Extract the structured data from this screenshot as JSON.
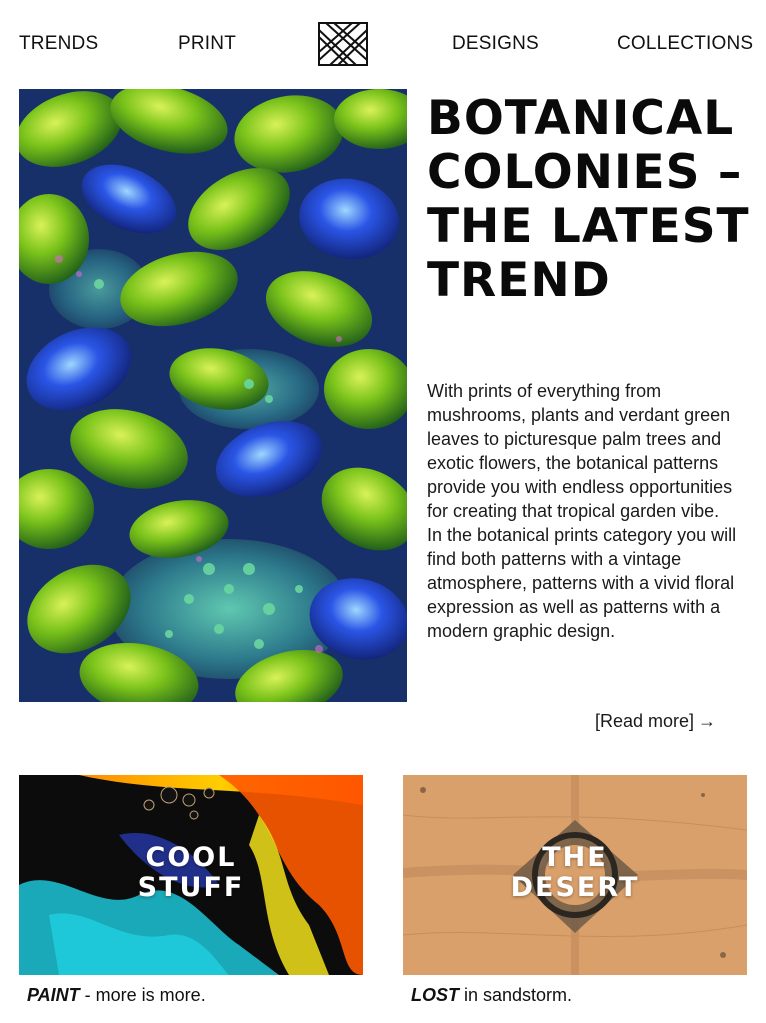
{
  "nav": {
    "items": [
      {
        "label": "TRENDS"
      },
      {
        "label": "PRINT"
      },
      {
        "label": "DESIGNS"
      },
      {
        "label": "COLLECTIONS"
      }
    ],
    "logo_icon": "crossed-lines-logo-icon"
  },
  "hero": {
    "title": "BOTANICAL COLONIES – THE LATEST TREND",
    "body": "With prints of everything from mushrooms, plants and verdant green leaves to picturesque palm trees and exotic flowers, the botanical patterns provide you with endless opportunities for creating that tropical garden vibe. In the botanical prints category you will find both patterns with a vintage atmosphere, patterns with a vivid floral expression as well as patterns with a modern graphic design.",
    "read_more": "[Read more]",
    "arrow": "→"
  },
  "cards": [
    {
      "title_line1": "COOL",
      "title_line2": "STUFF",
      "caption_bold": "PAINT",
      "caption_rest": " - more is more."
    },
    {
      "title_line1": "THE",
      "title_line2": "DESERT",
      "caption_bold": "LOST",
      "caption_rest": " in sandstorm."
    }
  ],
  "colors": {
    "leaf_green": "#7fc31c",
    "leaf_blue": "#1f3fd8",
    "desert_sand": "#d9a06b",
    "paint_orange": "#ff7a10"
  }
}
